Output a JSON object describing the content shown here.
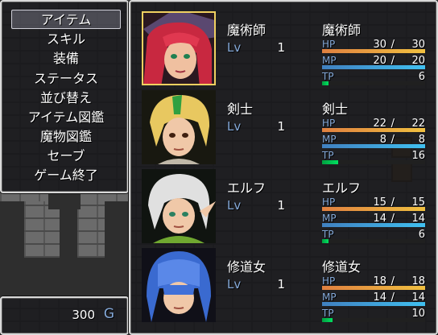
{
  "colors": {
    "system_blue": "#84a9d9",
    "hp_gradient": [
      "#e08040",
      "#f0c040"
    ],
    "mp_gradient": [
      "#4080c0",
      "#40c0f0"
    ],
    "tp_gradient": [
      "#00a040",
      "#00e060"
    ],
    "selection_border": "#f0d060"
  },
  "command_menu": {
    "items": [
      {
        "label": "アイテム",
        "selected": true
      },
      {
        "label": "スキル"
      },
      {
        "label": "装備"
      },
      {
        "label": "ステータス"
      },
      {
        "label": "並び替え"
      },
      {
        "label": "アイテム図鑑"
      },
      {
        "label": "魔物図鑑"
      },
      {
        "label": "セーブ"
      },
      {
        "label": "ゲーム終了"
      }
    ]
  },
  "gold": {
    "value": "300",
    "unit": "G"
  },
  "actors": [
    {
      "name": "魔術師",
      "class": "魔術師",
      "lv_label": "Lv",
      "level": "1",
      "face": "red-haired-witch-portrait",
      "selected": true,
      "hp": {
        "label": "HP",
        "current": "30",
        "max": "30",
        "ratio": 1.0
      },
      "mp": {
        "label": "MP",
        "current": "20",
        "max": "20",
        "ratio": 1.0
      },
      "tp": {
        "label": "TP",
        "current": "6",
        "ratio": 0.06
      }
    },
    {
      "name": "剣士",
      "class": "剣士",
      "lv_label": "Lv",
      "level": "1",
      "face": "blonde-swordswoman-portrait",
      "hp": {
        "label": "HP",
        "current": "22",
        "max": "22",
        "ratio": 1.0
      },
      "mp": {
        "label": "MP",
        "current": "8",
        "max": "8",
        "ratio": 1.0
      },
      "tp": {
        "label": "TP",
        "current": "16",
        "ratio": 0.16
      }
    },
    {
      "name": "エルフ",
      "class": "エルフ",
      "lv_label": "Lv",
      "level": "1",
      "face": "white-haired-elf-portrait",
      "hp": {
        "label": "HP",
        "current": "15",
        "max": "15",
        "ratio": 1.0
      },
      "mp": {
        "label": "MP",
        "current": "14",
        "max": "14",
        "ratio": 1.0
      },
      "tp": {
        "label": "TP",
        "current": "6",
        "ratio": 0.06
      }
    },
    {
      "name": "修道女",
      "class": "修道女",
      "lv_label": "Lv",
      "level": "1",
      "face": "blue-haired-nun-portrait",
      "hp": {
        "label": "HP",
        "current": "18",
        "max": "18",
        "ratio": 1.0
      },
      "mp": {
        "label": "MP",
        "current": "14",
        "max": "14",
        "ratio": 1.0
      },
      "tp": {
        "label": "TP",
        "current": "10",
        "ratio": 0.1
      }
    }
  ]
}
